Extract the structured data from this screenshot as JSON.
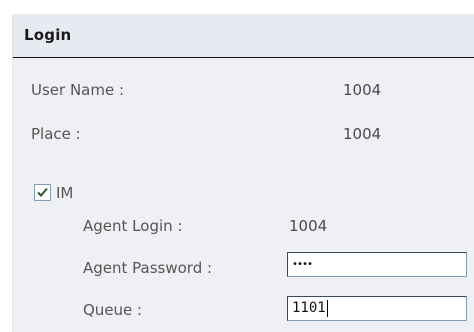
{
  "header": {
    "title": "Login"
  },
  "fields": {
    "user_name": {
      "label": "User Name :",
      "value": "1004"
    },
    "place": {
      "label": "Place :",
      "value": "1004"
    }
  },
  "im": {
    "label": "IM",
    "checked": true
  },
  "agent": {
    "login_label": "Agent Login :",
    "login_value": "1004",
    "password_label": "Agent Password :",
    "password_masked": "••••",
    "queue_label": "Queue :",
    "queue_value": "1101"
  },
  "icons": {
    "checkbox_check": "check-icon"
  },
  "colors": {
    "panel_bg": "#eef0f4",
    "header_bg": "#e7eaf0",
    "check": "#2a5a2a"
  }
}
